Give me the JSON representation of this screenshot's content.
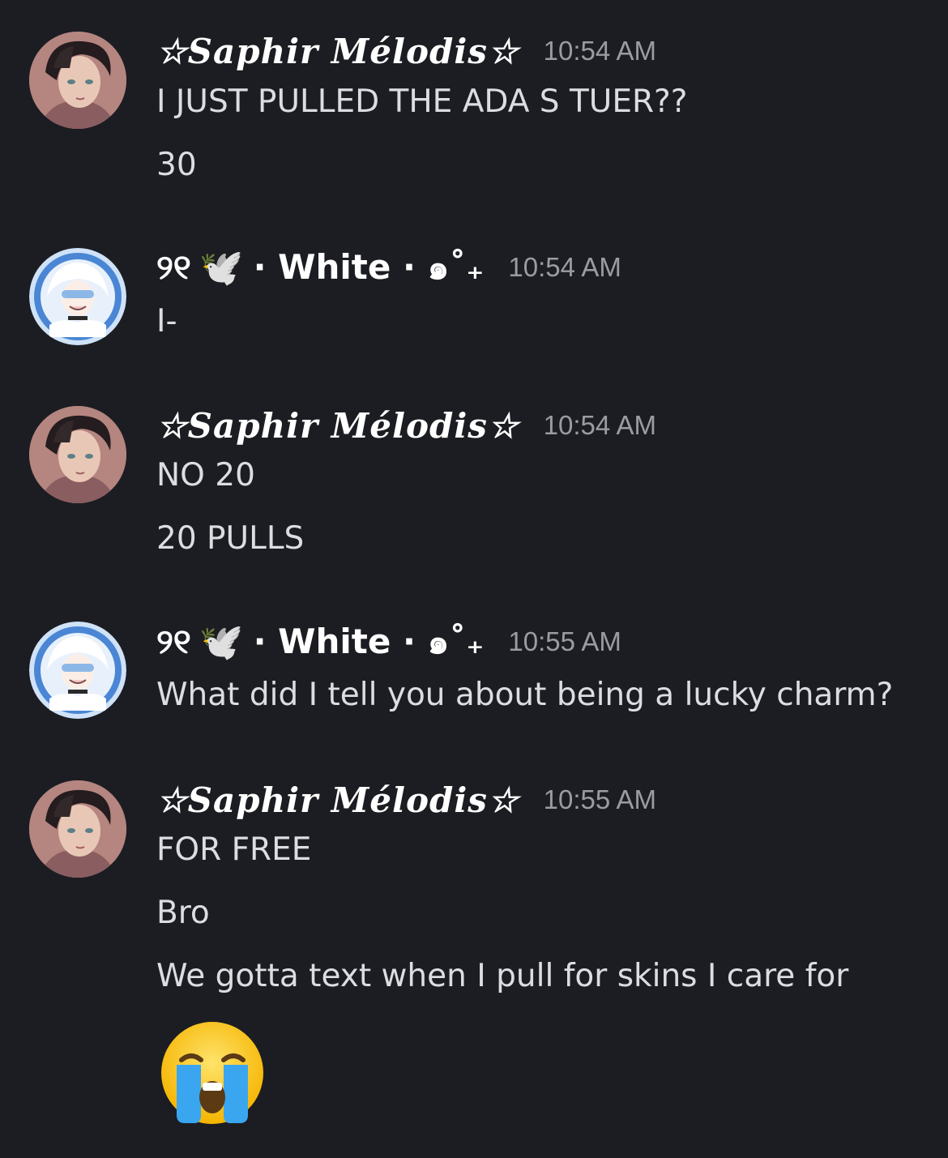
{
  "messages": [
    {
      "author": "☆Saphir Mélodis☆",
      "time": "10:54 AM",
      "lines": [
        "I JUST PULLED THE ADA S TUER??",
        "30"
      ]
    },
    {
      "author_prefix": "୨୧",
      "author_emoji": "🕊️",
      "author": "· White · ๑˚₊",
      "time": "10:54 AM",
      "lines": [
        "I-"
      ]
    },
    {
      "author": "☆Saphir Mélodis☆",
      "time": "10:54 AM",
      "lines": [
        "NO 20",
        "20 PULLS"
      ]
    },
    {
      "author_prefix": "୨୧",
      "author_emoji": "🕊️",
      "author": "· White · ๑˚₊",
      "time": "10:55 AM",
      "lines": [
        "What did I tell you about being a lucky charm?"
      ]
    },
    {
      "author": "☆Saphir Mélodis☆",
      "time": "10:55 AM",
      "lines": [
        "FOR FREE",
        "Bro",
        "We gotta text when I pull for skins I care for"
      ],
      "emoji": "loudly-crying-face"
    }
  ],
  "colors": {
    "background": "#1c1d22",
    "username": "#ffffff",
    "timestamp": "#9b9ca3",
    "message_text": "#dcdde1"
  }
}
